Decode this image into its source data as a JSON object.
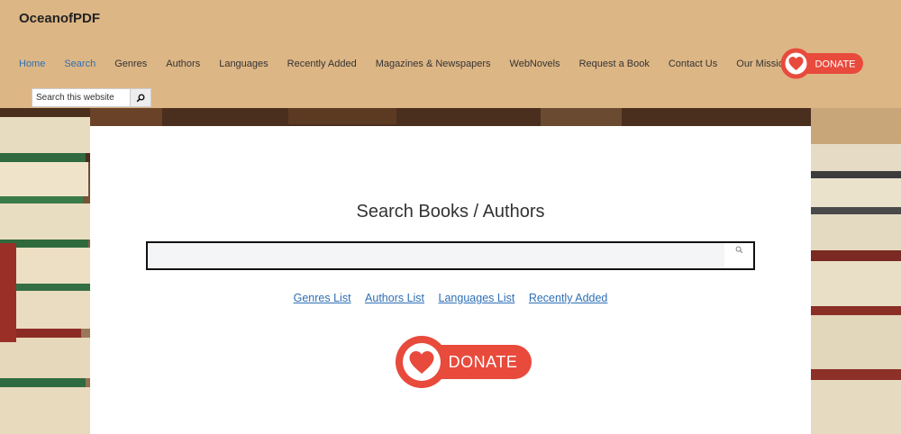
{
  "site": {
    "title": "OceanofPDF"
  },
  "nav": {
    "items": [
      {
        "label": "Home",
        "active": true
      },
      {
        "label": "Search",
        "active": true
      },
      {
        "label": "Genres"
      },
      {
        "label": "Authors"
      },
      {
        "label": "Languages"
      },
      {
        "label": "Recently Added"
      },
      {
        "label": "Magazines & Newspapers"
      },
      {
        "label": "WebNovels"
      },
      {
        "label": "Request a Book"
      },
      {
        "label": "Contact Us"
      },
      {
        "label": "Our Mission"
      }
    ],
    "donate_label": "DONATE"
  },
  "header_search": {
    "placeholder": "Search this website",
    "icon": "search-icon"
  },
  "main": {
    "title": "Search Books / Authors",
    "search_value": "",
    "links": [
      "Genres List",
      "Authors List",
      "Languages List",
      "Recently Added"
    ],
    "donate_label": "DONATE"
  },
  "colors": {
    "header_bg": "#ddb685",
    "link": "#2e6fb6",
    "donate_red": "#e84a3c"
  }
}
